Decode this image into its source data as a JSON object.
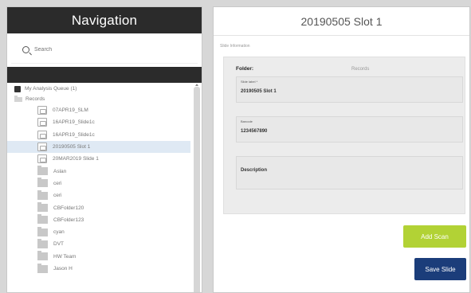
{
  "navigation": {
    "title": "Navigation",
    "search_placeholder": "Search",
    "tree": {
      "queue_label": "My Analysis Queue (1)",
      "records_label": "Records",
      "items": [
        {
          "label": "07APR19_SLM",
          "type": "slide",
          "selected": false
        },
        {
          "label": "16APR19_Slide1c",
          "type": "slide",
          "selected": false
        },
        {
          "label": "16APR19_Slide1c",
          "type": "slide",
          "selected": false
        },
        {
          "label": "20190505 Slot 1",
          "type": "slide",
          "selected": true
        },
        {
          "label": "20MAR2019 Slide 1",
          "type": "slide",
          "selected": false
        },
        {
          "label": "Aslan",
          "type": "folder",
          "selected": false
        },
        {
          "label": "ceri",
          "type": "folder",
          "selected": false
        },
        {
          "label": "ceri",
          "type": "folder",
          "selected": false
        },
        {
          "label": "CBFolder120",
          "type": "folder",
          "selected": false
        },
        {
          "label": "CBFolder123",
          "type": "folder",
          "selected": false
        },
        {
          "label": "cyan",
          "type": "folder",
          "selected": false
        },
        {
          "label": "DVT",
          "type": "folder",
          "selected": false
        },
        {
          "label": "HW Team",
          "type": "folder",
          "selected": false
        },
        {
          "label": "Jason H",
          "type": "folder",
          "selected": false
        }
      ]
    }
  },
  "detail": {
    "title": "20190505 Slot 1",
    "section_label": "Slide Information",
    "folder_label": "Folder:",
    "folder_value": "Records",
    "slide_label_caption": "Slide label *",
    "slide_label_value": "20190505 Slot 1",
    "barcode_caption": "Barcode",
    "barcode_value": "1234567890",
    "description_label": "Description",
    "add_scan_label": "Add Scan",
    "save_slide_label": "Save Slide"
  },
  "colors": {
    "header_bg": "#2b2b2b",
    "add_scan": "#b2d235",
    "save_slide": "#1b3d7a",
    "selected_row": "#dfe9f4"
  }
}
